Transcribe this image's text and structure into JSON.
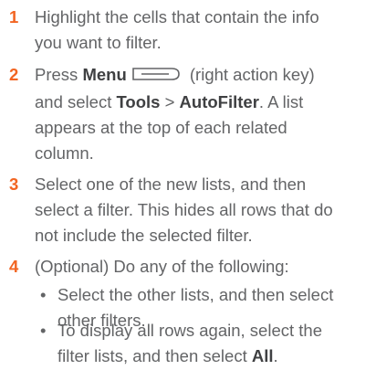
{
  "steps": [
    {
      "num": "1",
      "line1": "Highlight the cells that contain the info",
      "line2": "you want to filter."
    },
    {
      "num": "2",
      "press": "Press ",
      "menu": "Menu",
      "after_key": " (right action key)",
      "and_select": "and select ",
      "tools": "Tools",
      "gt": " > ",
      "autofilter": "AutoFilter",
      "rest1": ". A list",
      "line3": "appears at the top of each related",
      "line4": "column."
    },
    {
      "num": "3",
      "line1": "Select one of the new lists, and then",
      "line2": "select a filter. This hides all rows that do",
      "line3": "not include the selected filter."
    },
    {
      "num": "4",
      "line1": "(Optional)  Do any of the following:"
    }
  ],
  "bullets": [
    {
      "dot": "•",
      "line1": "Select the other lists, and then select",
      "line2": "other filters."
    },
    {
      "dot": "•",
      "line1": "To display all rows again, select the",
      "line2_pre": "filter lists, and then select ",
      "all": "All",
      "line2_post": "."
    }
  ],
  "icons": {
    "menu_key": "menu-key-icon"
  },
  "colors": {
    "step_number": "#f26522",
    "text": "#636466",
    "bold_text": "#3f4042"
  }
}
